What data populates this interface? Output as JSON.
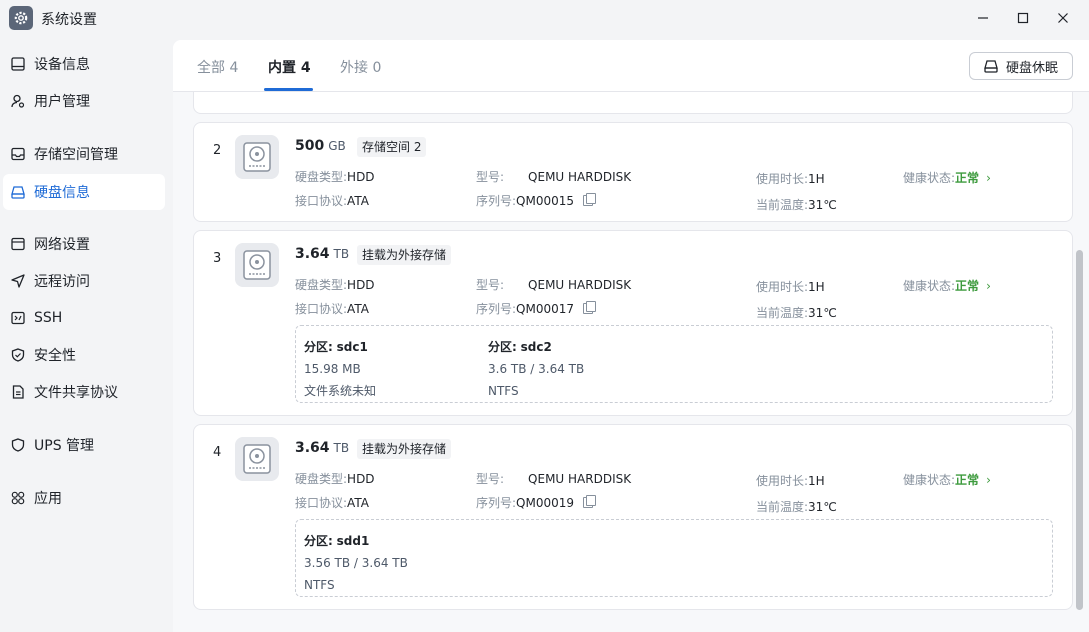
{
  "window": {
    "title": "系统设置"
  },
  "sidebar": {
    "items": [
      {
        "label": "设备信息"
      },
      {
        "label": "用户管理"
      },
      {
        "label": "存储空间管理"
      },
      {
        "label": "硬盘信息"
      },
      {
        "label": "网络设置"
      },
      {
        "label": "远程访问"
      },
      {
        "label": "SSH"
      },
      {
        "label": "安全性"
      },
      {
        "label": "文件共享协议"
      },
      {
        "label": "UPS 管理"
      },
      {
        "label": "应用"
      }
    ]
  },
  "tabs": [
    {
      "label": "全部 4"
    },
    {
      "label": "内置 4"
    },
    {
      "label": "外接 0"
    }
  ],
  "toolbar": {
    "sleep_label": "硬盘休眠"
  },
  "labels": {
    "disk_type": "硬盘类型:",
    "interface": "接口协议:",
    "model": "型号:",
    "serial": "序列号:",
    "usage_time": "使用时长:",
    "temperature": "当前温度:",
    "health": "健康状态:",
    "partition": "分区:"
  },
  "disks": [
    {
      "index": "2",
      "capacity": "500",
      "unit": "GB",
      "tag": "存储空间 2",
      "type": "HDD",
      "interface": "ATA",
      "model": "QEMU HARDDISK",
      "serial": "QM00015",
      "usage": "1H",
      "temp": "31℃",
      "health": "正常"
    },
    {
      "index": "3",
      "capacity": "3.64",
      "unit": "TB",
      "tag": "挂载为外接存储",
      "type": "HDD",
      "interface": "ATA",
      "model": "QEMU HARDDISK",
      "serial": "QM00017",
      "usage": "1H",
      "temp": "31℃",
      "health": "正常",
      "partitions": [
        {
          "name": "sdc1",
          "size": "15.98 MB",
          "fs": "文件系统未知"
        },
        {
          "name": "sdc2",
          "size": "3.6 TB / 3.64 TB",
          "fs": "NTFS"
        }
      ]
    },
    {
      "index": "4",
      "capacity": "3.64",
      "unit": "TB",
      "tag": "挂载为外接存储",
      "type": "HDD",
      "interface": "ATA",
      "model": "QEMU HARDDISK",
      "serial": "QM00019",
      "usage": "1H",
      "temp": "31℃",
      "health": "正常",
      "partitions": [
        {
          "name": "sdd1",
          "size": "3.56 TB / 3.64 TB",
          "fs": "NTFS"
        }
      ]
    }
  ],
  "colors": {
    "accent": "#1f6bd6",
    "healthy": "#3e9b3e"
  }
}
